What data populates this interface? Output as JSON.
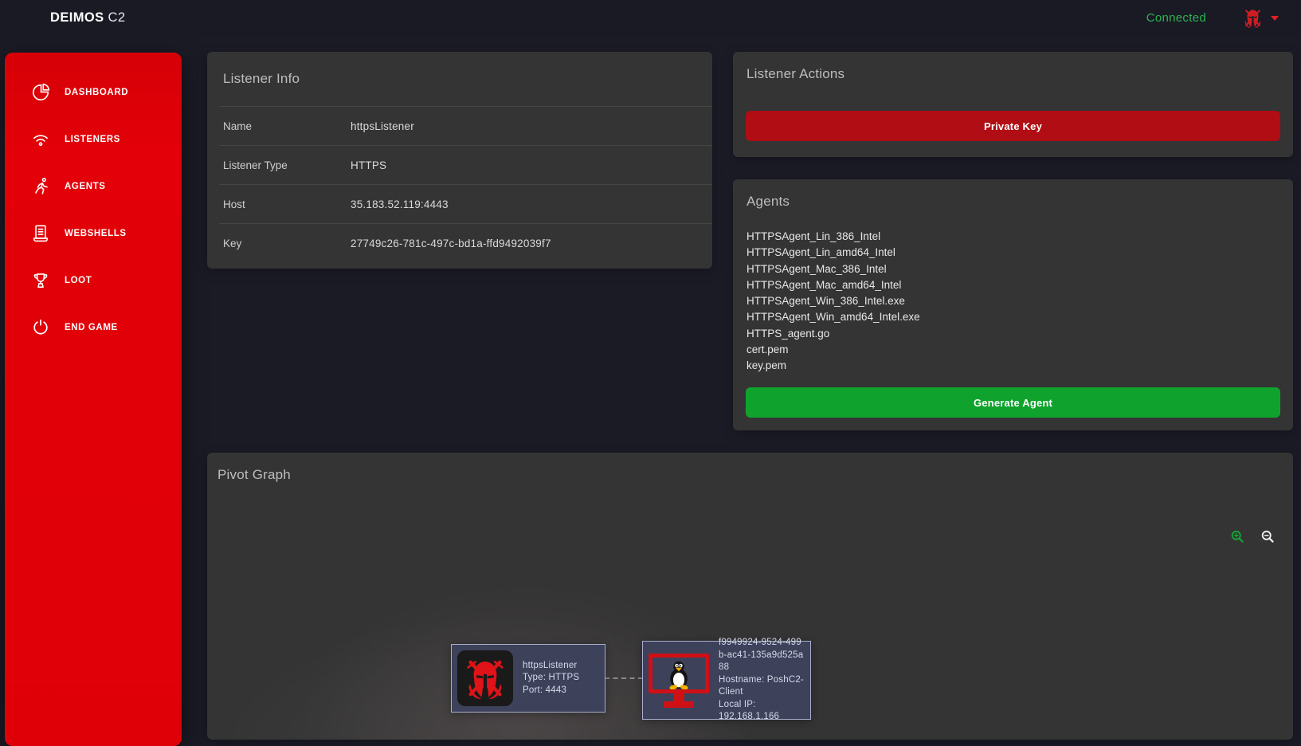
{
  "topbar": {
    "brand": "DEIMOS",
    "brand_suffix": "C2",
    "status": "Connected",
    "avatar_icon": "spartan-helmet-icon"
  },
  "sidebar": {
    "items": [
      {
        "label": "DASHBOARD",
        "icon": "pie-chart-icon"
      },
      {
        "label": "LISTENERS",
        "icon": "wifi-icon"
      },
      {
        "label": "AGENTS",
        "icon": "running-person-icon"
      },
      {
        "label": "WEBSHELLS",
        "icon": "document-icon"
      },
      {
        "label": "LOOT",
        "icon": "trophy-icon"
      },
      {
        "label": "END GAME",
        "icon": "power-icon"
      }
    ]
  },
  "listener_info": {
    "title": "Listener Info",
    "rows": [
      {
        "label": "Name",
        "value": "httpsListener"
      },
      {
        "label": "Listener Type",
        "value": "HTTPS"
      },
      {
        "label": "Host",
        "value": "35.183.52.119:4443"
      },
      {
        "label": "Key",
        "value": "27749c26-781c-497c-bd1a-ffd9492039f7"
      }
    ]
  },
  "listener_actions": {
    "title": "Listener Actions",
    "private_key_label": "Private Key"
  },
  "agents": {
    "title": "Agents",
    "files": [
      "HTTPSAgent_Lin_386_Intel",
      "HTTPSAgent_Lin_amd64_Intel",
      "HTTPSAgent_Mac_386_Intel",
      "HTTPSAgent_Mac_amd64_Intel",
      "HTTPSAgent_Win_386_Intel.exe",
      "HTTPSAgent_Win_amd64_Intel.exe",
      "HTTPS_agent.go",
      "cert.pem",
      "key.pem"
    ],
    "generate_label": "Generate Agent"
  },
  "pivot_graph": {
    "title": "Pivot Graph",
    "controls": {
      "zoom_in": "magnifier-plus-icon",
      "zoom_out": "magnifier-minus-icon"
    },
    "listener_node": {
      "icon": "spartan-helmet-icon",
      "name": "httpsListener",
      "type_line": "Type: HTTPS",
      "port_line": "Port: 4443"
    },
    "agent_node": {
      "icon": "linux-tux-monitor-icon",
      "id": "f9949924-9524-499b-ac41-135a9d525a88",
      "hostname_line": "Hostname: PoshC2-Client",
      "local_ip_line": "Local IP: 192.168.1.166"
    }
  },
  "colors": {
    "page_bg": "#1a1b25",
    "panel_bg": "#343434",
    "sidebar_red": "#e10408",
    "button_red": "#b00d14",
    "button_green": "#0fa32d",
    "connected_green": "#2eb350",
    "node_bg": "#3d415a",
    "node_border": "#a9b0cc",
    "monitor_red": "#cf1016"
  }
}
